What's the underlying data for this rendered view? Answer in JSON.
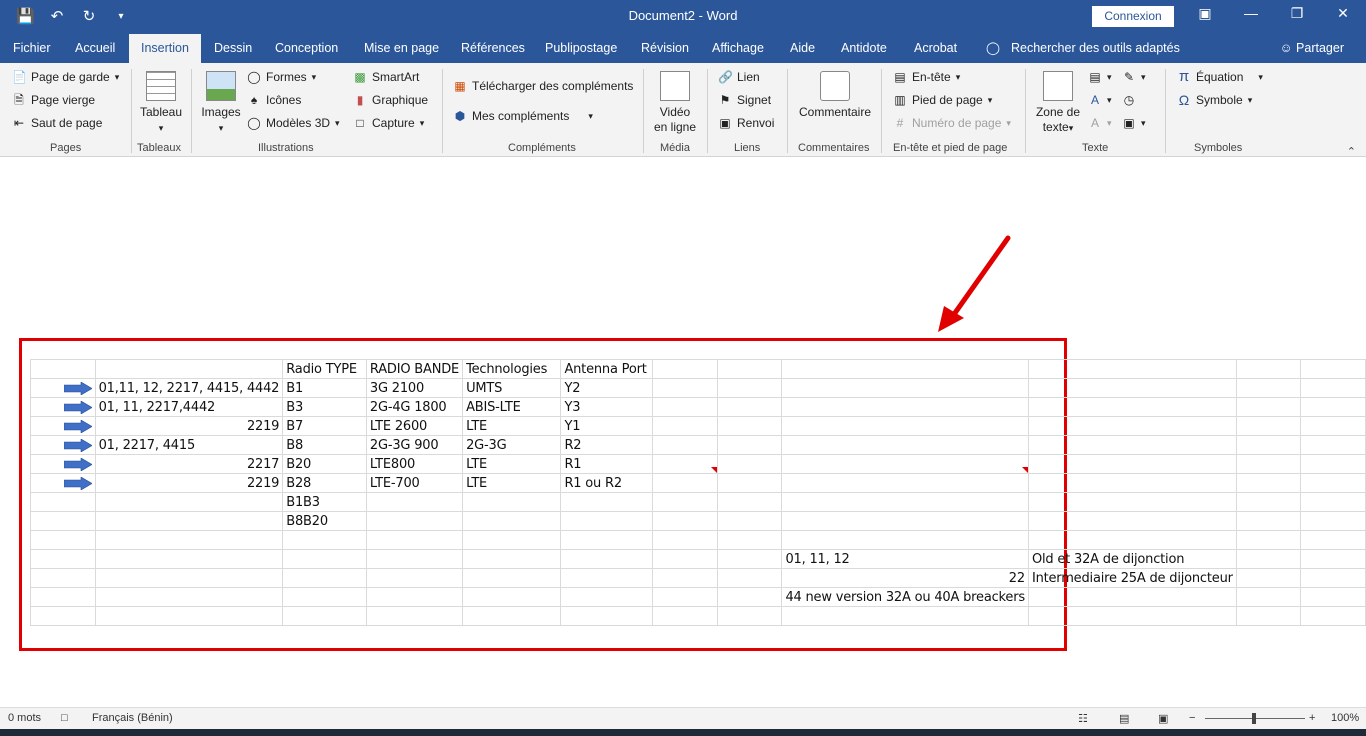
{
  "window": {
    "title": "Document2 - Word",
    "signin_label": "Connexion",
    "qat_icons": [
      "save-icon",
      "undo-icon",
      "redo-icon",
      "customize-qat-icon"
    ]
  },
  "tabs": [
    "Fichier",
    "Accueil",
    "Insertion",
    "Dessin",
    "Conception",
    "Mise en page",
    "Références",
    "Publipostage",
    "Révision",
    "Affichage",
    "Aide",
    "Antidote",
    "Acrobat"
  ],
  "active_tab": "Insertion",
  "tell_me": "Rechercher des outils adaptés",
  "share_label": "Partager",
  "ribbon": {
    "pages": {
      "label": "Pages",
      "items": [
        "Page de garde",
        "Page vierge",
        "Saut de page"
      ]
    },
    "tableaux": {
      "label": "Tableaux",
      "tableau": "Tableau"
    },
    "illustrations": {
      "label": "Illustrations",
      "images": "Images",
      "formes": "Formes",
      "icones": "Icônes",
      "modeles3d": "Modèles 3D",
      "smartart": "SmartArt",
      "graphique": "Graphique",
      "capture": "Capture"
    },
    "complements": {
      "label": "Compléments",
      "telecharger": "Télécharger des compléments",
      "mes": "Mes compléments"
    },
    "media": {
      "label": "Média",
      "video_line1": "Vidéo",
      "video_line2": "en ligne"
    },
    "liens": {
      "label": "Liens",
      "lien": "Lien",
      "signet": "Signet",
      "renvoi": "Renvoi"
    },
    "commentaires": {
      "label": "Commentaires",
      "commentaire": "Commentaire"
    },
    "entete": {
      "label": "En-tête et pied de page",
      "entete": "En-tête",
      "pied": "Pied de page",
      "numero": "Numéro de page"
    },
    "texte": {
      "label": "Texte",
      "zone_line1": "Zone de",
      "zone_line2": "texte"
    },
    "symboles": {
      "label": "Symboles",
      "equation": "Équation",
      "symbole": "Symbole"
    }
  },
  "sheet": {
    "header": [
      "",
      "",
      "Radio TYPE",
      "RADIO BANDE",
      "Technologies",
      "Antenna Port",
      "",
      "",
      "",
      "",
      "",
      ""
    ],
    "rows": [
      {
        "arrow": true,
        "b": "01,11, 12, 2217, 4415, 4442",
        "b_align": "left",
        "c": "B1",
        "d": "3G 2100",
        "e": "UMTS",
        "f": "Y2"
      },
      {
        "arrow": true,
        "b": "01, 11, 2217,4442",
        "b_align": "left",
        "c": "B3",
        "d": "2G-4G 1800",
        "e": "ABIS-LTE",
        "f": "Y3"
      },
      {
        "arrow": true,
        "b": "2219",
        "b_align": "right",
        "c": "B7",
        "d": "LTE 2600",
        "e": "LTE",
        "f": "Y1"
      },
      {
        "arrow": true,
        "b": "01, 2217, 4415",
        "b_align": "left",
        "c": "B8",
        "d": "2G-3G 900",
        "e": "2G-3G",
        "f": "R2"
      },
      {
        "arrow": true,
        "b": "2217",
        "b_align": "right",
        "c": "B20",
        "d": "LTE800",
        "e": "LTE",
        "f": "R1"
      },
      {
        "arrow": true,
        "b": "2219",
        "b_align": "right",
        "c": "B28",
        "d": "LTE-700",
        "e": "LTE",
        "f": "R1 ou R2"
      },
      {
        "arrow": false,
        "b": "",
        "c": "B1B3",
        "d": "",
        "e": "",
        "f": ""
      },
      {
        "arrow": false,
        "b": "",
        "c": "B8B20",
        "d": "",
        "e": "",
        "f": ""
      }
    ],
    "notes": [
      {
        "j": "01, 11, 12",
        "k": "Old et 32A de dijonction"
      },
      {
        "j": "22",
        "k": "Intermediaire 25A de dijoncteur"
      },
      {
        "j": "44 new version 32A ou 40A breackers",
        "k": ""
      }
    ]
  },
  "status": {
    "words": "0 mots",
    "language": "Français (Bénin)",
    "zoom": "100%"
  },
  "colors": {
    "brand": "#2b579a",
    "highlight": "#e00000",
    "arrow": "#3f6fc6"
  }
}
